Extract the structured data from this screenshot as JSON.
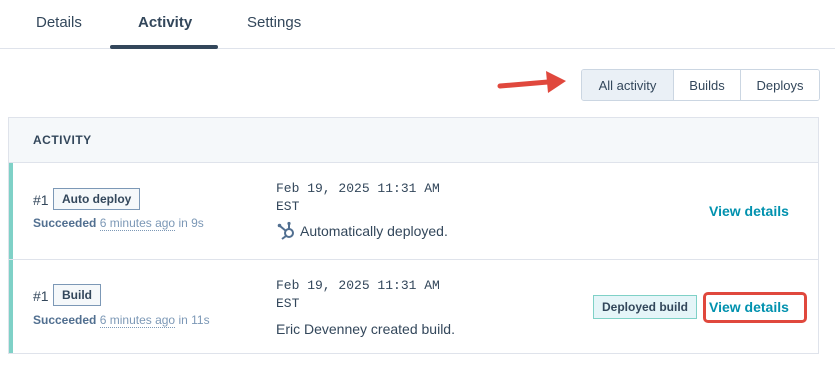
{
  "tabs": [
    {
      "label": "Details"
    },
    {
      "label": "Activity",
      "active": true
    },
    {
      "label": "Settings"
    }
  ],
  "filters": {
    "options": [
      {
        "label": "All activity",
        "active": true
      },
      {
        "label": "Builds"
      },
      {
        "label": "Deploys"
      }
    ]
  },
  "activity": {
    "header": "ACTIVITY",
    "rows": [
      {
        "number": "#1",
        "type_tag": "Auto deploy",
        "status": "Succeeded",
        "time_ago": "6 minutes ago",
        "duration": "in 9s",
        "timestamp": "Feb 19, 2025 11:31 AM\nEST",
        "description": "Automatically deployed.",
        "description_icon": "hubspot-sprocket-icon",
        "action": "View details"
      },
      {
        "number": "#1",
        "type_tag": "Build",
        "status": "Succeeded",
        "time_ago": "6 minutes ago",
        "duration": "in 11s",
        "timestamp": "Feb 19, 2025 11:31 AM\nEST",
        "description": "Eric Devenney created build.",
        "badge": "Deployed build",
        "action": "View details"
      }
    ]
  },
  "colors": {
    "accent_teal": "#7fd1c7",
    "link": "#0091ae",
    "annotation_red": "#e0483d"
  }
}
